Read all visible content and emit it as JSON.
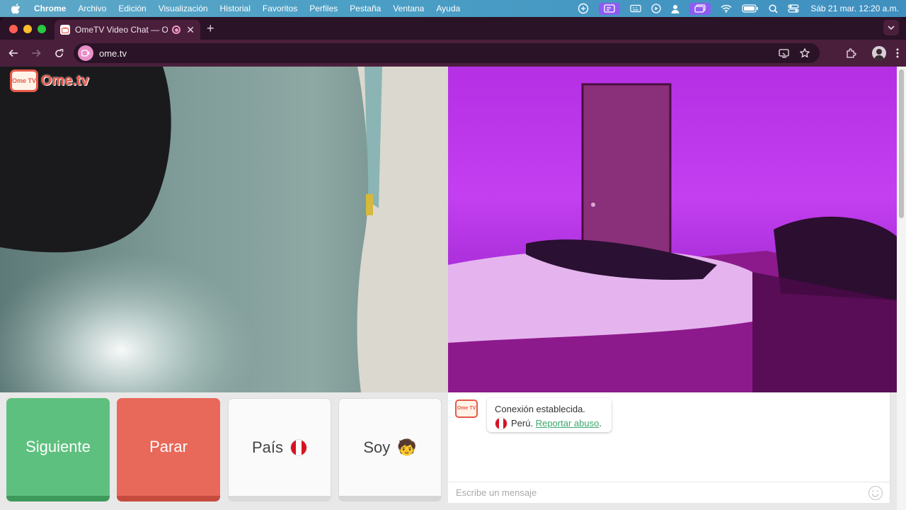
{
  "menubar": {
    "app_name": "Chrome",
    "items": [
      "Archivo",
      "Edición",
      "Visualización",
      "Historial",
      "Favoritos",
      "Perfiles",
      "Pestaña",
      "Ventana",
      "Ayuda"
    ],
    "clock": "Sáb 21 mar.  12:20 a.m."
  },
  "browser": {
    "tab_title": "OmeTV Video Chat — Om",
    "url": "ome.tv"
  },
  "page": {
    "logo_badge": "Ome TV",
    "logo_text": "Ome.tv",
    "buttons": {
      "next": "Siguiente",
      "stop": "Parar",
      "country": "País",
      "iam": "Soy",
      "iam_emoji": "🧒"
    },
    "chat": {
      "connection": "Conexión establecida.",
      "country": "Perú.",
      "report": "Reportar abuso",
      "message_placeholder": "Escribe un mensaje"
    }
  },
  "colors": {
    "accent_green": "#5ec07e",
    "accent_red": "#e8685a",
    "link_green": "#3aa76d",
    "peru_red": "#d91023"
  }
}
